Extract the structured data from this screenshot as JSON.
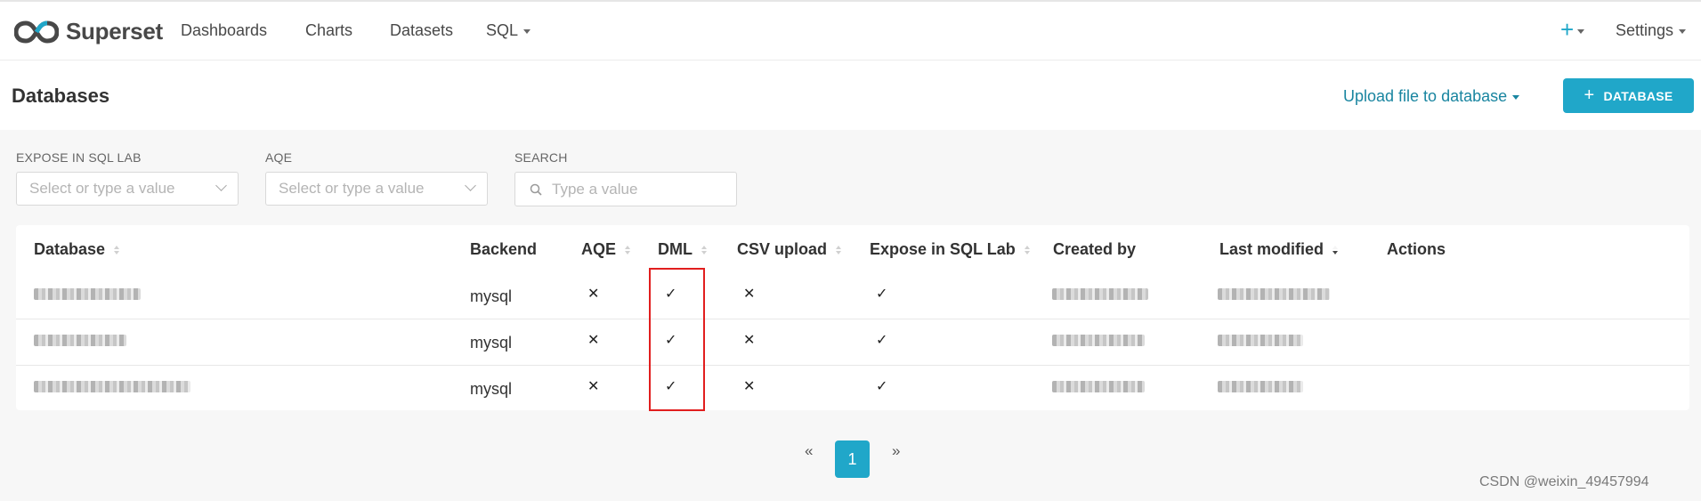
{
  "nav": {
    "brand": "Superset",
    "items": [
      "Dashboards",
      "Charts",
      "Datasets",
      "SQL"
    ],
    "plus": "+",
    "settings": "Settings"
  },
  "subheader": {
    "title": "Databases",
    "upload": "Upload file to database",
    "add_database": "DATABASE"
  },
  "filters": {
    "expose_label": "EXPOSE IN SQL LAB",
    "expose_placeholder": "Select or type a value",
    "aqe_label": "AQE",
    "aqe_placeholder": "Select or type a value",
    "search_label": "SEARCH",
    "search_placeholder": "Type a value"
  },
  "table": {
    "columns": [
      "Database",
      "Backend",
      "AQE",
      "DML",
      "CSV upload",
      "Expose in SQL Lab",
      "Created by",
      "Last modified",
      "Actions"
    ],
    "rows": [
      {
        "backend": "mysql",
        "aqe": "✕",
        "dml": "✓",
        "csv": "✕",
        "expose": "✓"
      },
      {
        "backend": "mysql",
        "aqe": "✕",
        "dml": "✓",
        "csv": "✕",
        "expose": "✓"
      },
      {
        "backend": "mysql",
        "aqe": "✕",
        "dml": "✓",
        "csv": "✕",
        "expose": "✓"
      }
    ]
  },
  "pagination": {
    "prev": "«",
    "current": "1",
    "next": "»"
  },
  "watermark": "CSDN @weixin_49457994",
  "colors": {
    "accent": "#20a7c9",
    "highlight": "#e11e1e"
  }
}
